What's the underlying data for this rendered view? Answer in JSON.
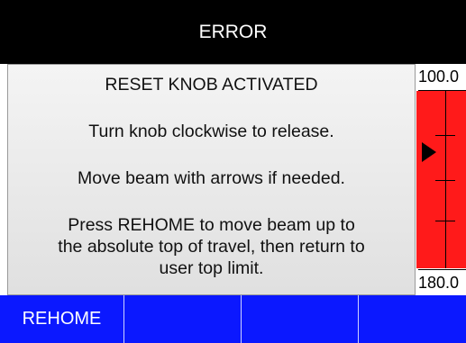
{
  "header": {
    "title": "ERROR"
  },
  "message": {
    "heading": "RESET KNOB ACTIVATED",
    "line1": "Turn knob clockwise to release.",
    "line2": "Move beam with arrows if needed.",
    "line3a": "Press REHOME to move beam up to",
    "line3b": "the absolute top of travel, then return to",
    "line3c": "user top limit."
  },
  "gauge": {
    "top_value": "100.0",
    "bottom_value": "180.0",
    "pointer_icon": "triangle-right-icon",
    "fill_color": "#ff1a1a"
  },
  "softkeys": [
    {
      "label": "REHOME"
    },
    {
      "label": ""
    },
    {
      "label": ""
    },
    {
      "label": ""
    }
  ],
  "colors": {
    "title_bg": "#000000",
    "softkey_bg": "#0b18ff"
  }
}
